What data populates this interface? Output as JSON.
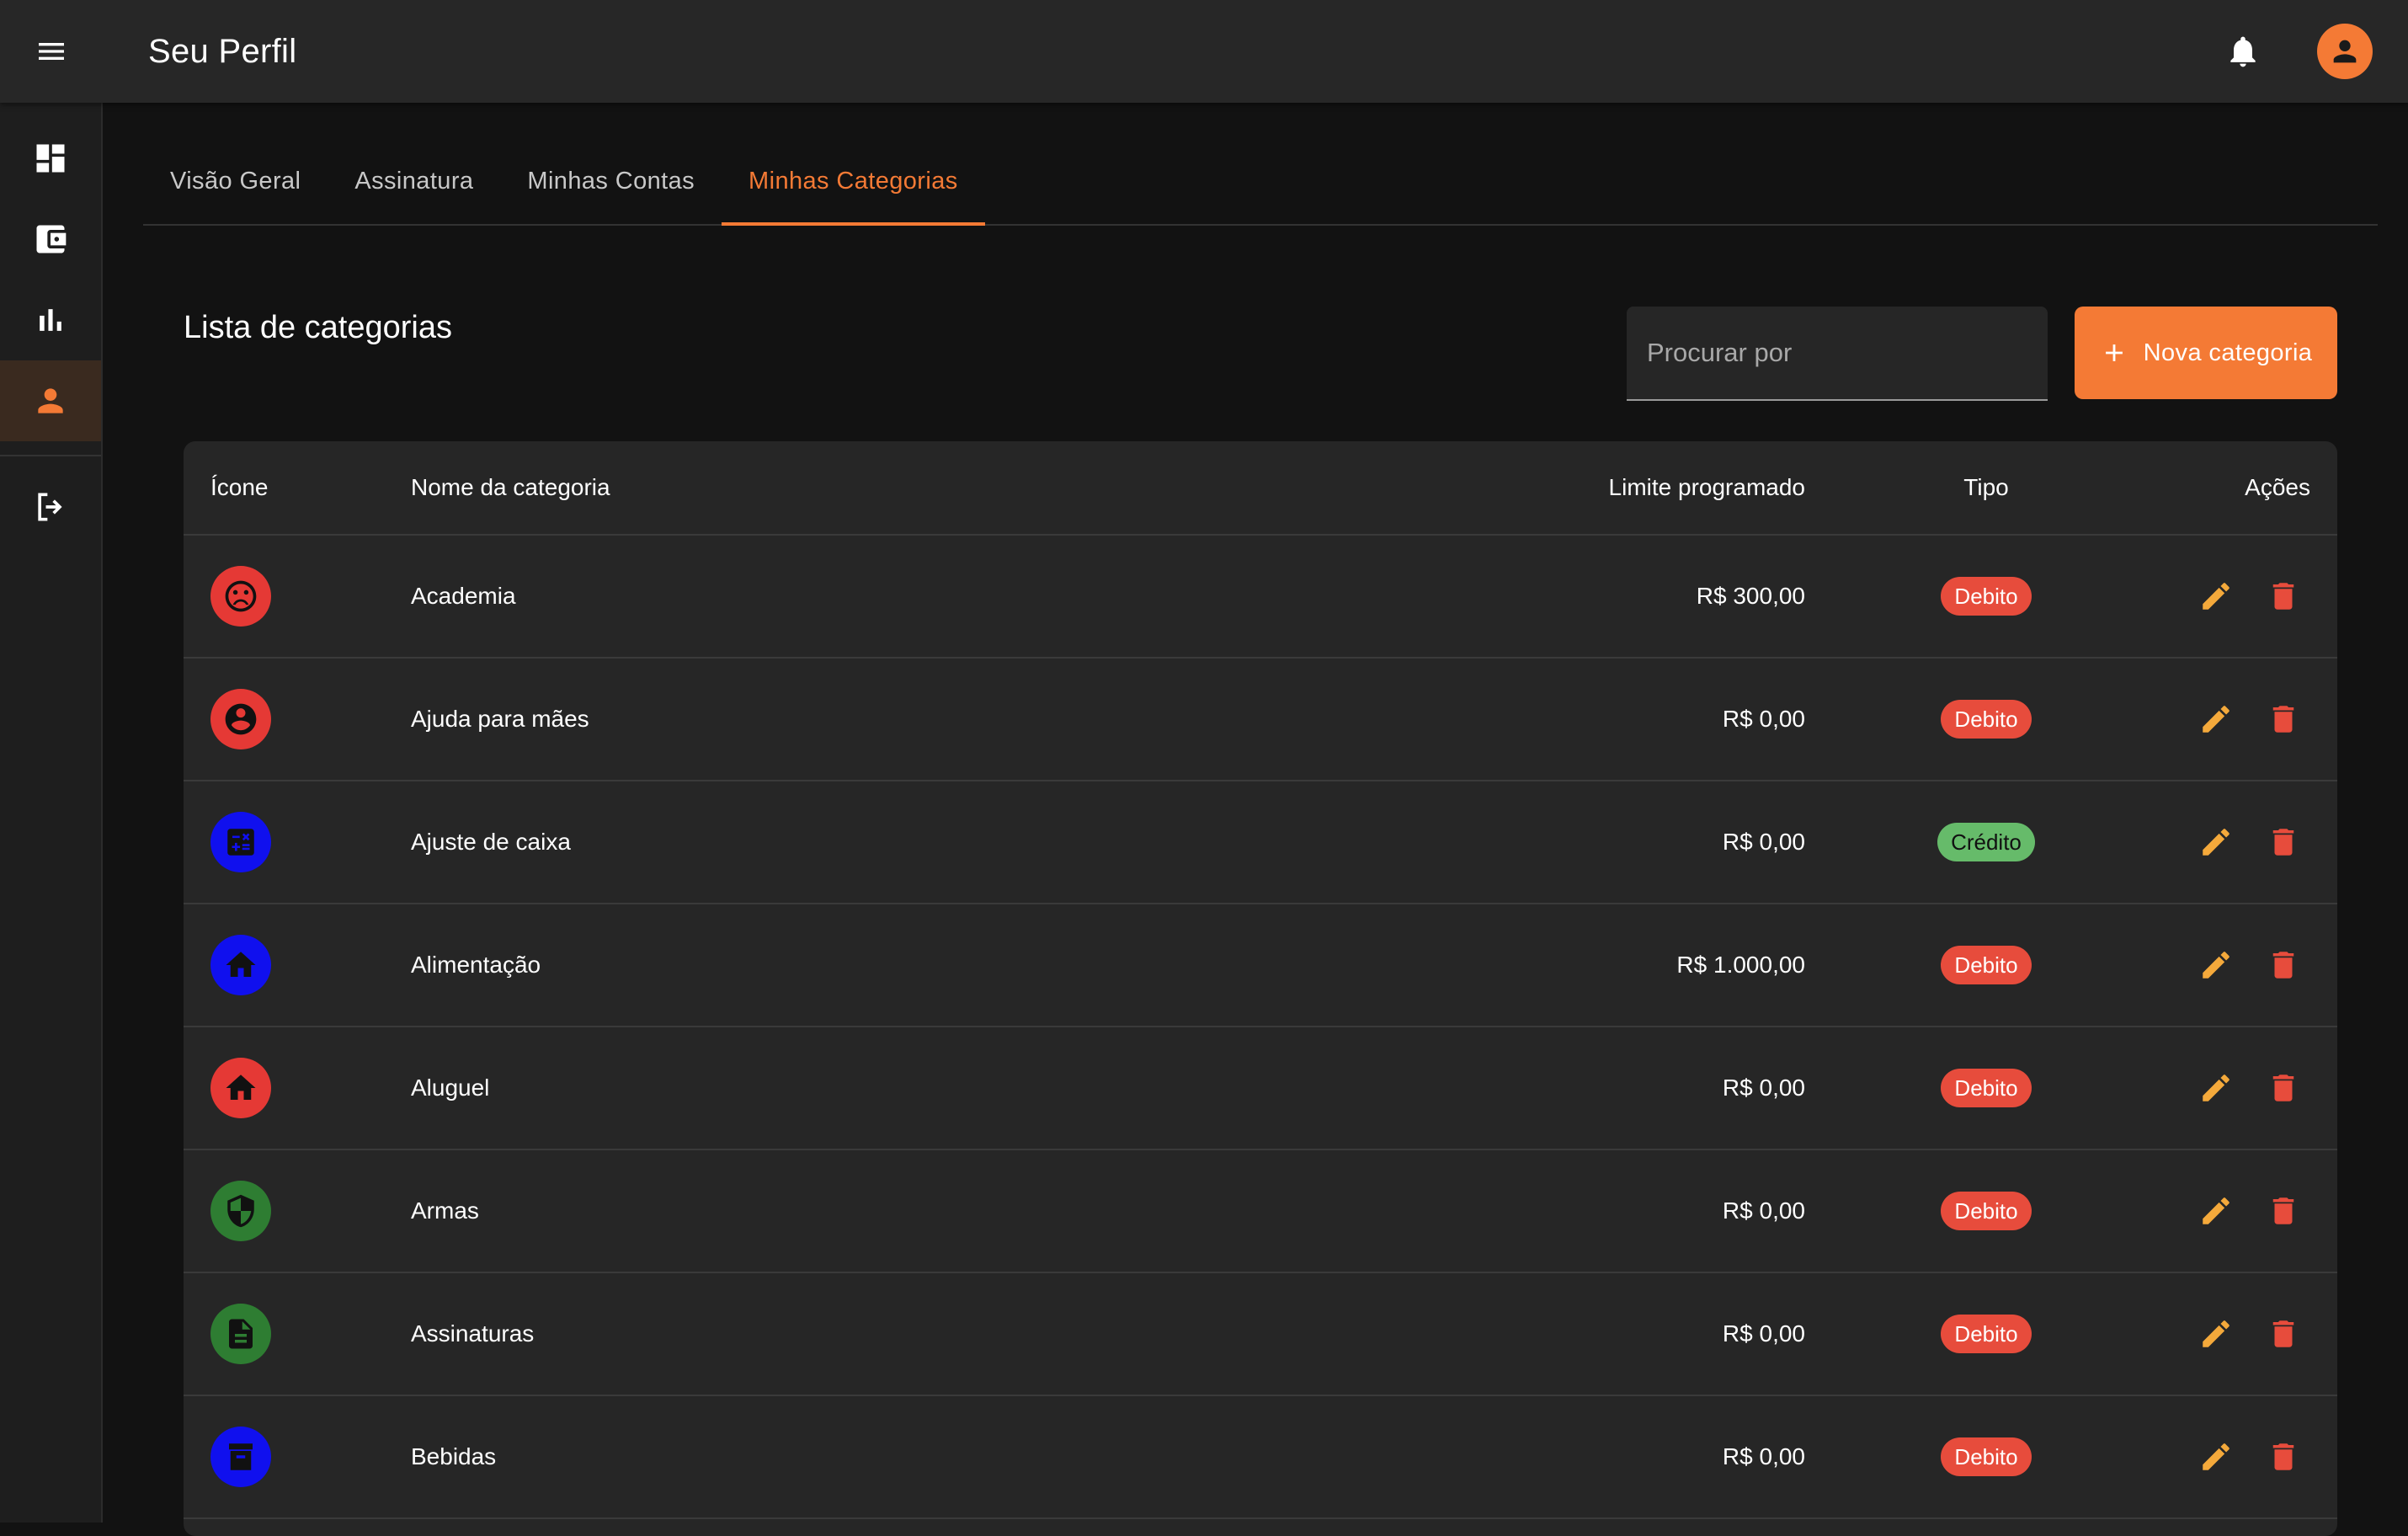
{
  "header": {
    "title": "Seu Perfil",
    "menu_icon": "menu-icon",
    "bell_icon": "bell-icon",
    "avatar_icon": "person-icon",
    "accent": "#f47a35"
  },
  "sidebar": {
    "items": [
      {
        "icon": "dashboard-icon",
        "active": false
      },
      {
        "icon": "wallet-icon",
        "active": false
      },
      {
        "icon": "bar-chart-icon",
        "active": false
      },
      {
        "icon": "person-icon",
        "active": true
      },
      {
        "icon": "logout-icon",
        "active": false
      }
    ]
  },
  "tabs": [
    {
      "label": "Visão Geral",
      "active": false
    },
    {
      "label": "Assinatura",
      "active": false
    },
    {
      "label": "Minhas Contas",
      "active": false
    },
    {
      "label": "Minhas Categorias",
      "active": true
    }
  ],
  "section": {
    "title": "Lista de categorias",
    "search_placeholder": "Procurar por",
    "new_button_label": "Nova categoria"
  },
  "table": {
    "headers": {
      "icon": "Ícone",
      "name": "Nome da categoria",
      "limit": "Limite programado",
      "type": "Tipo",
      "actions": "Ações"
    },
    "rows": [
      {
        "icon": "sad-face-icon",
        "color": "#e53935",
        "name": "Academia",
        "limit": "R$ 300,00",
        "type": "Debito",
        "kind": "debito"
      },
      {
        "icon": "account-circle-icon",
        "color": "#e53935",
        "name": "Ajuda para mães",
        "limit": "R$ 0,00",
        "type": "Debito",
        "kind": "debito"
      },
      {
        "icon": "calculator-icon",
        "color": "#1010ee",
        "name": "Ajuste de caixa",
        "limit": "R$ 0,00",
        "type": "Crédito",
        "kind": "credito"
      },
      {
        "icon": "home-icon",
        "color": "#1010ee",
        "name": "Alimentação",
        "limit": "R$ 1.000,00",
        "type": "Debito",
        "kind": "debito"
      },
      {
        "icon": "home-icon",
        "color": "#e53935",
        "name": "Aluguel",
        "limit": "R$ 0,00",
        "type": "Debito",
        "kind": "debito"
      },
      {
        "icon": "shield-icon",
        "color": "#2e7d32",
        "name": "Armas",
        "limit": "R$ 0,00",
        "type": "Debito",
        "kind": "debito"
      },
      {
        "icon": "document-icon",
        "color": "#2e7d32",
        "name": "Assinaturas",
        "limit": "R$ 0,00",
        "type": "Debito",
        "kind": "debito"
      },
      {
        "icon": "archive-icon",
        "color": "#1010ee",
        "name": "Bebidas",
        "limit": "R$ 0,00",
        "type": "Debito",
        "kind": "debito"
      }
    ],
    "edit_icon": "pencil-icon",
    "delete_icon": "trash-icon",
    "edit_color": "#f4a93b",
    "delete_color": "#e74c3c"
  }
}
